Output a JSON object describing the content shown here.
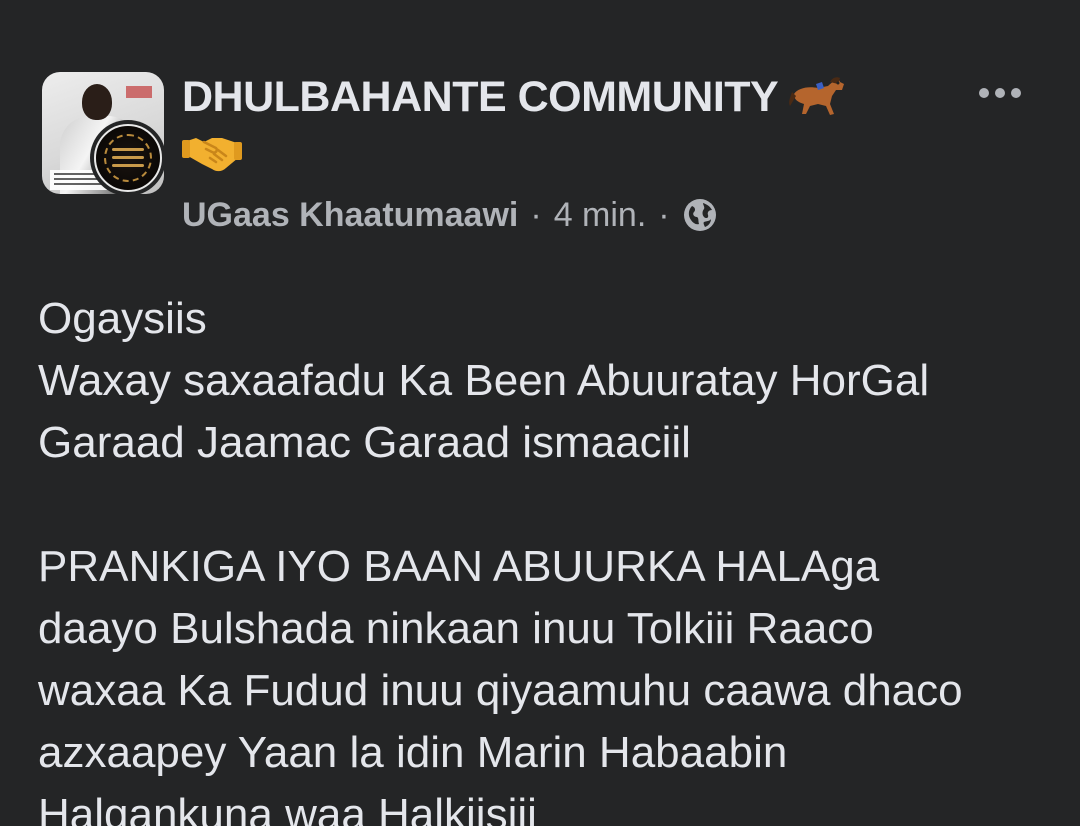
{
  "post": {
    "group_name": "DHULBAHANTE COMMUNITY",
    "author": "UGaas Khaatumaawi",
    "separator": "·",
    "time": "4 min.",
    "privacy_icon": "globe-icon",
    "more_icon": "more-options-icon",
    "title_emojis": [
      "horse-emoji",
      "handshake-emoji"
    ],
    "body": "Ogaysiis\nWaxay saxaafadu Ka Been Abuuratay HorGal\nGaraad Jaamac Garaad ismaaciil\n\nPRANKIGA IYO BAAN ABUURKA HALAga\ndaayo Bulshada ninkaan inuu Tolkiii Raaco\nwaxaa Ka Fudud inuu qiyaamuhu caawa dhaco\nazxaapey Yaan la idin Marin Habaabin\nHalgankuna waa Halkiisiii"
  },
  "colors": {
    "background": "#242526",
    "primary_text": "#e4e6eb",
    "secondary_text": "#b0b3b8"
  }
}
